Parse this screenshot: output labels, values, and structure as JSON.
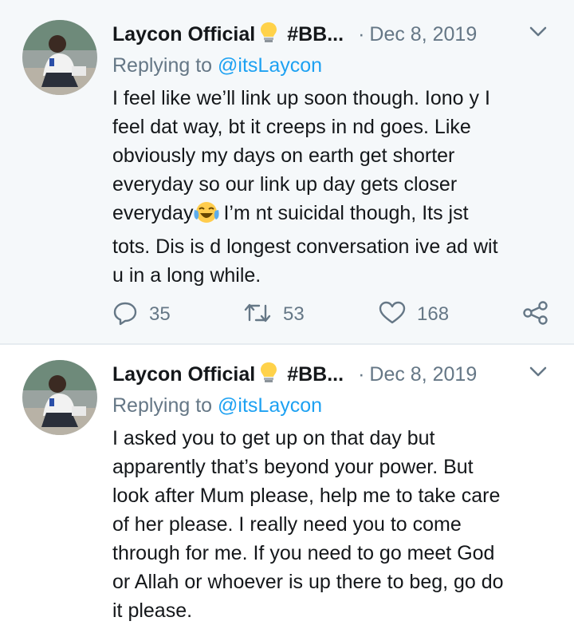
{
  "tweets": [
    {
      "author": "Laycon Official",
      "tag": "#BB...",
      "separator": "·",
      "date": "Dec 8, 2019",
      "replying_prefix": "Replying to",
      "replying_handle": "@itsLaycon",
      "lines": [
        "I feel like we’ll link up soon though. Iono y I",
        "feel dat way, bt it creeps in nd goes. Like",
        "obviously my days on earth get shorter",
        "everyday so our link up day gets closer",
        "everyday",
        "I’m nt suicidal though, Its jst",
        "tots. Dis is d longest conversation ive ad wit",
        "u in a long while."
      ],
      "replies": "35",
      "retweets": "53",
      "likes": "168"
    },
    {
      "author": "Laycon Official",
      "tag": "#BB...",
      "separator": "·",
      "date": "Dec 8, 2019",
      "replying_prefix": "Replying to",
      "replying_handle": "@itsLaycon",
      "lines": [
        "I asked you to get up on that day but",
        "apparently that’s beyond your power. But",
        "look after Mum please, help me to take care",
        "of her please. I really need you to come",
        "through for me. If you need to go meet God",
        "or Allah or whoever is up there to beg, go do",
        "it please."
      ]
    }
  ],
  "icons": {
    "bulb": "lightbulb-icon",
    "chevron": "chevron-down-icon",
    "emoji": "tears-of-joy-emoji",
    "reply": "reply-icon",
    "retweet": "retweet-icon",
    "like": "heart-icon",
    "share": "share-icon"
  },
  "colors": {
    "link": "#1da1f2",
    "secondary_text": "#657786",
    "highlight_bg": "#f5f8fa"
  }
}
